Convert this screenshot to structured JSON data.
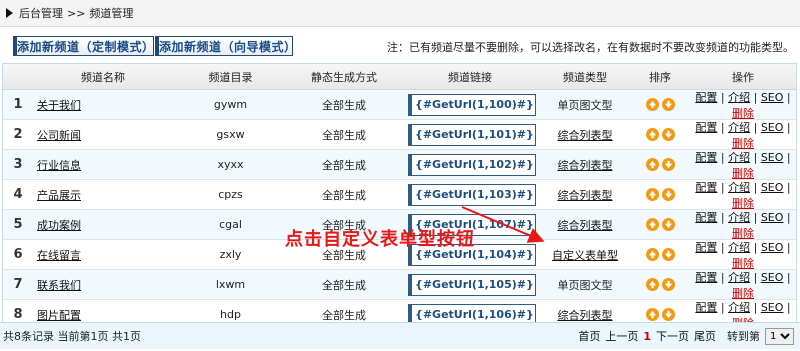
{
  "breadcrumb": {
    "root": "后台管理",
    "sep": ">>",
    "current": "频道管理"
  },
  "toolbar": {
    "add_custom_label": "添加新频道（定制模式）",
    "add_wizard_label": "添加新频道（向导模式）",
    "note": "注：已有频道尽量不要删除，可以选择改名，在有数据时不要改变频道的功能类型。"
  },
  "table": {
    "headers": [
      "",
      "频道名称",
      "频道目录",
      "静态生成方式",
      "频道链接",
      "频道类型",
      "排序",
      "操作"
    ],
    "rows": [
      {
        "num": "1",
        "name": "关于我们",
        "dir": "gywm",
        "gen": "全部生成",
        "url": "{#GetUrl(1,100)#}",
        "type": "单页图文型",
        "type_link": false
      },
      {
        "num": "2",
        "name": "公司新闻",
        "dir": "gsxw",
        "gen": "全部生成",
        "url": "{#GetUrl(1,101)#}",
        "type": "综合列表型",
        "type_link": true
      },
      {
        "num": "3",
        "name": "行业信息",
        "dir": "xyxx",
        "gen": "全部生成",
        "url": "{#GetUrl(1,102)#}",
        "type": "综合列表型",
        "type_link": true
      },
      {
        "num": "4",
        "name": "产品展示",
        "dir": "cpzs",
        "gen": "全部生成",
        "url": "{#GetUrl(1,103)#}",
        "type": "综合列表型",
        "type_link": true
      },
      {
        "num": "5",
        "name": "成功案例",
        "dir": "cgal",
        "gen": "全部生成",
        "url": "{#GetUrl(1,107)#}",
        "type": "综合列表型",
        "type_link": true
      },
      {
        "num": "6",
        "name": "在线留言",
        "dir": "zxly",
        "gen": "全部生成",
        "url": "{#GetUrl(1,104)#}",
        "type": "自定义表单型",
        "type_link": true
      },
      {
        "num": "7",
        "name": "联系我们",
        "dir": "lxwm",
        "gen": "全部生成",
        "url": "{#GetUrl(1,105)#}",
        "type": "单页图文型",
        "type_link": false
      },
      {
        "num": "8",
        "name": "图片配置",
        "dir": "hdp",
        "gen": "全部生成",
        "url": "{#GetUrl(1,106)#}",
        "type": "综合列表型",
        "type_link": true
      }
    ],
    "ops": {
      "config": "配置",
      "intro": "介绍",
      "seo": "SEO",
      "delete": "删除",
      "sep": "|"
    },
    "sort_icons": [
      "arrow-up-icon",
      "arrow-down-icon"
    ]
  },
  "footer": {
    "summary": "共8条记录 当前第1页 共1页",
    "first": "首页",
    "prev": "上一页",
    "current_page": "1",
    "next": "下一页",
    "last": "尾页",
    "goto_label": "转到第",
    "goto_value": "1"
  },
  "annotation": {
    "text": "点击自定义表单型按钮"
  },
  "colors": {
    "accent": "#1f4a7a",
    "url_text": "#1a4d80",
    "sort_icon": "#f39a12",
    "delete": "#cc0000",
    "annotation": "#e81818"
  }
}
